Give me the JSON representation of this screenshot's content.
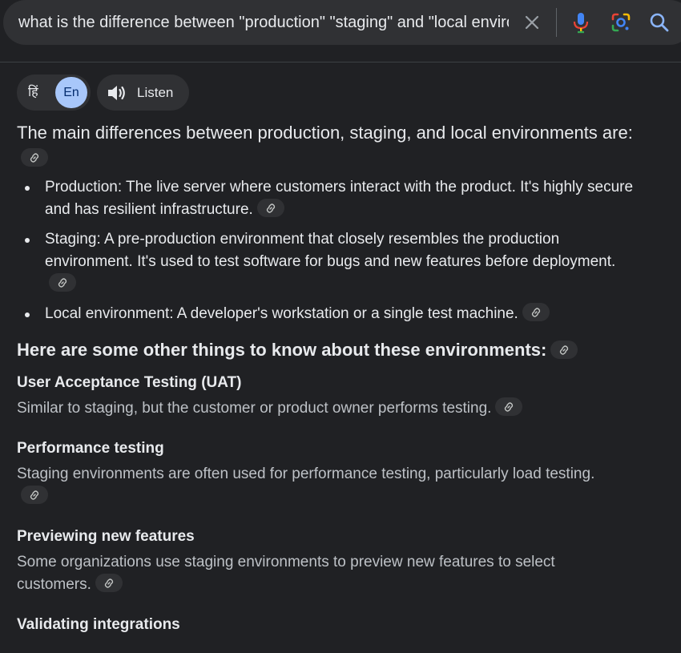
{
  "search": {
    "query": "what is the difference between \"production\" \"staging\" and \"local enviro"
  },
  "icons": {
    "clear": "close-icon",
    "voice": "microphone-icon",
    "lens": "camera-lens-icon",
    "search": "search-icon",
    "speaker": "speaker-icon",
    "link": "link-icon"
  },
  "language": {
    "hindi": "हिं",
    "english": "En"
  },
  "listen": {
    "label": "Listen"
  },
  "overview": {
    "intro": "The main differences between production, staging, and local environments are:",
    "bullets": [
      "Production: The live server where customers interact with the product. It's highly secure and has resilient infrastructure.",
      "Staging: A pre-production environment that closely resembles the production environment. It's used to test software for bugs and new features before deployment.",
      "Local environment: A developer's workstation or a single test machine."
    ],
    "heading": "Here are some other things to know about these environments:",
    "sections": [
      {
        "title": "User Acceptance Testing (UAT)",
        "body": "Similar to staging, but the customer or product owner performs testing."
      },
      {
        "title": "Performance testing",
        "body": "Staging environments are often used for performance testing, particularly load testing."
      },
      {
        "title": "Previewing new features",
        "body": "Some organizations use staging environments to preview new features to select customers."
      },
      {
        "title": "Validating integrations",
        "body": ""
      }
    ]
  },
  "colors": {
    "background": "#202124",
    "surface": "#303134",
    "accent": "#a8c7fa",
    "text": "#e8eaed",
    "muted_text": "#bdc1c6"
  }
}
